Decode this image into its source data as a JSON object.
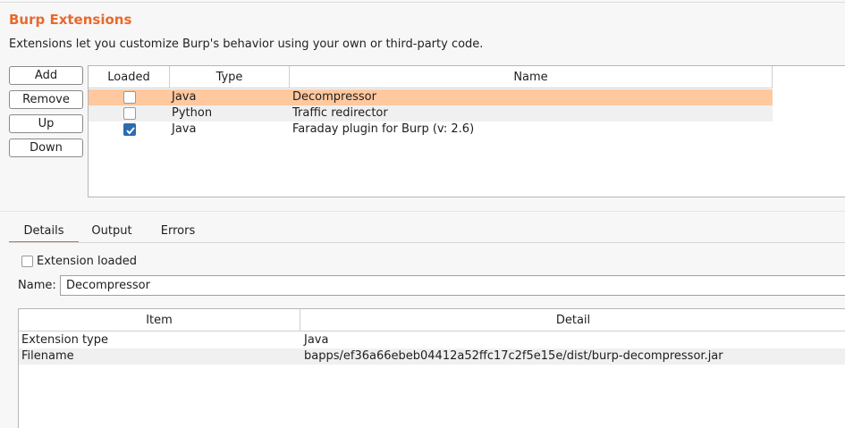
{
  "header": {
    "title": "Burp Extensions",
    "description": "Extensions let you customize Burp's behavior using your own or third-party code."
  },
  "buttons": {
    "add": "Add",
    "remove": "Remove",
    "up": "Up",
    "down": "Down"
  },
  "extensions_table": {
    "columns": [
      "Loaded",
      "Type",
      "Name"
    ],
    "rows": [
      {
        "loaded": false,
        "type": "Java",
        "name": "Decompressor",
        "selected": true
      },
      {
        "loaded": false,
        "type": "Python",
        "name": "Traffic redirector",
        "selected": false
      },
      {
        "loaded": true,
        "type": "Java",
        "name": "Faraday plugin for Burp (v: 2.6)",
        "selected": false
      }
    ]
  },
  "tabs": [
    {
      "label": "Details",
      "active": true
    },
    {
      "label": "Output",
      "active": false
    },
    {
      "label": "Errors",
      "active": false
    }
  ],
  "details": {
    "extension_loaded_label": "Extension loaded",
    "extension_loaded": false,
    "name_label": "Name:",
    "name_value": "Decompressor",
    "table": {
      "columns": [
        "Item",
        "Detail"
      ],
      "rows": [
        {
          "item": "Extension type",
          "detail": "Java"
        },
        {
          "item": "Filename",
          "detail": "bapps/ef36a66ebeb04412a52ffc17c2f5e15e/dist/burp-decompressor.jar"
        }
      ]
    }
  },
  "colors": {
    "accent": "#e8692e",
    "selected_row": "#ffc89f",
    "checkbox_checked": "#2b6cb0"
  }
}
